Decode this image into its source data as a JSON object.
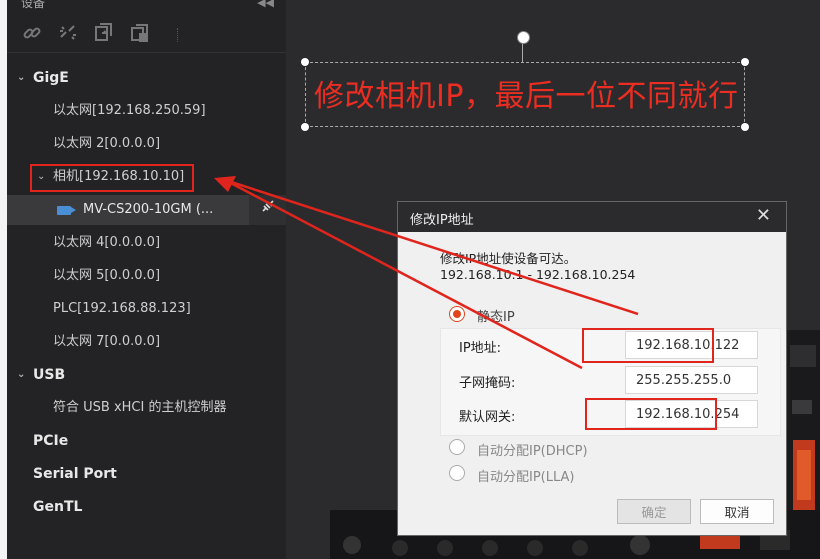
{
  "panel": {
    "title": "设备",
    "toolbar": [
      "link-icon",
      "unlink-icon",
      "refresh-icon",
      "multi-window-icon"
    ]
  },
  "tree": {
    "categories": {
      "gige": "GigE",
      "usb": "USB",
      "pcie": "PCIe",
      "serial": "Serial Port",
      "gentl": "GenTL"
    },
    "gige_items": {
      "eth1": "以太网[192.168.250.59]",
      "eth2": "以太网 2[0.0.0.0]",
      "camera": "相机[192.168.10.10]",
      "camera_device": "MV-CS200-10GM (...",
      "eth4": "以太网 4[0.0.0.0]",
      "eth5": "以太网 5[0.0.0.0]",
      "plc": "PLC[192.168.88.123]",
      "eth7": "以太网 7[0.0.0.0]"
    },
    "usb_items": {
      "host": "符合 USB xHCI 的主机控制器"
    }
  },
  "annotation": {
    "text": "修改相机IP，最后一位不同就行",
    "color": "#ec2d22"
  },
  "dialog": {
    "title": "修改IP地址",
    "desc_line1": "修改IP地址使设备可达。",
    "desc_line2": "192.168.10.1 - 192.168.10.254",
    "static_ip": "静态IP",
    "ip_label": "IP地址:",
    "ip_value": "192.168.10.122",
    "mask_label": "子网掩码:",
    "mask_value": "255.255.255.0",
    "gateway_label": "默认网关:",
    "gateway_value": "192.168.10.254",
    "dhcp": "自动分配IP(DHCP)",
    "lla": "自动分配IP(LLA)",
    "ok": "确定",
    "cancel": "取消"
  },
  "colors": {
    "annotation_red": "#e0251d",
    "radio_accent": "#e0451d",
    "camera_icon": "#4a8ed6"
  }
}
